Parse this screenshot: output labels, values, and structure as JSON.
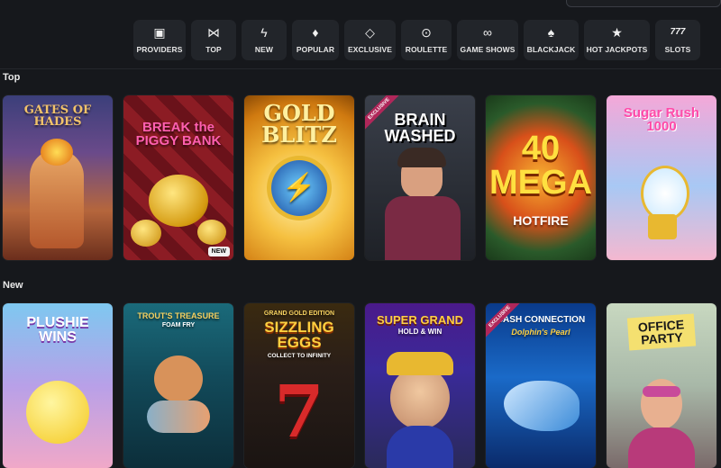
{
  "nav": {
    "items": [
      {
        "label": "PROVIDERS",
        "icon": "providers-icon",
        "glyph": "▣"
      },
      {
        "label": "TOP",
        "icon": "bowtie-icon",
        "glyph": "⋈"
      },
      {
        "label": "NEW",
        "icon": "lightning-icon",
        "glyph": "ϟ"
      },
      {
        "label": "POPULAR",
        "icon": "flame-icon",
        "glyph": "♦"
      },
      {
        "label": "EXCLUSIVE",
        "icon": "diamond-icon",
        "glyph": "◇"
      },
      {
        "label": "ROULETTE",
        "icon": "roulette-icon",
        "glyph": "⊙"
      },
      {
        "label": "GAME SHOWS",
        "icon": "mask-icon",
        "glyph": "∞"
      },
      {
        "label": "BLACKJACK",
        "icon": "cards-icon",
        "glyph": "♠"
      },
      {
        "label": "HOT JACKPOTS",
        "icon": "jackpot-icon",
        "glyph": "★"
      },
      {
        "label": "SLOTS",
        "icon": "slots-777-icon",
        "glyph": "777"
      }
    ]
  },
  "sections": {
    "top": {
      "title": "Top",
      "games": [
        {
          "title": "GATES OF HADES",
          "badge": ""
        },
        {
          "title": "BREAK the PIGGY BANK",
          "badge": "NEW"
        },
        {
          "title": "GOLD BLITZ",
          "badge": ""
        },
        {
          "title": "BRAIN WASHED",
          "badge": "EXCLUSIVE"
        },
        {
          "title": "40 MEGA",
          "subtitle": "HOTFIRE",
          "badge": ""
        },
        {
          "title": "Sugar Rush 1000",
          "badge": ""
        }
      ]
    },
    "new": {
      "title": "New",
      "games": [
        {
          "title": "PLUSHIE WINS",
          "badge": ""
        },
        {
          "title": "TROUT'S TREASURE",
          "subtitle": "FOAM FRY",
          "badge": ""
        },
        {
          "title": "SIZZLING EGGS",
          "subtitle": "COLLECT TO INFINITY",
          "overline": "GRAND GOLD EDITION",
          "badge": ""
        },
        {
          "title": "SUPER GRAND",
          "subtitle": "HOLD & WIN",
          "badge": ""
        },
        {
          "title": "CASH CONNECTION",
          "subtitle": "Dolphin's Pearl",
          "badge": "EXCLUSIVE"
        },
        {
          "title": "OFFICE PARTY",
          "badge": ""
        }
      ]
    }
  },
  "colors": {
    "background": "#16181c",
    "nav_button": "#22252a",
    "accent_exclusive": "#b0275a"
  }
}
